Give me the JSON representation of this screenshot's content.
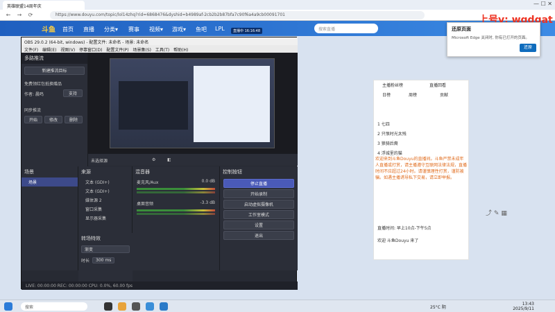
{
  "browser": {
    "tab_title": "英雄联盟14周年庆",
    "url": "https://www.douyu.com/topic/lol14zhq?rid=6868476&dyshid=b4989af-2cb2b2b87bfa7c90f6a4a9cb00091701",
    "window_controls": "—  ☐  ✕"
  },
  "douyu": {
    "logo": "斗鱼",
    "nav": [
      "首页",
      "直播",
      "分类▾",
      "赛事",
      "视频▾",
      "游戏▾",
      "鱼吧",
      "LPL"
    ],
    "live_badge": "直播中 16:16:48",
    "search_placeholder": "搜索直播",
    "watermark": "上号v: wgdgat",
    "right_panel": {
      "tabs": [
        "主播粉丝榜",
        "直播回看"
      ],
      "subtabs": [
        "日榜",
        "周榜",
        "贡献"
      ],
      "ranks": [
        "1 七四",
        "2 只恨时光太残",
        "3 狼骑后裔",
        "4 浮城里的猫"
      ],
      "chat": "欢迎来到斗鱼Douyu的直播间。斗鱼严禁未成年人直播或打赏，请主播遵守互联网法律法规，直播时间不应超过24小时。请谨慎理性打赏，谨防被骗。如遇主播诱导私下交易，请立即举报。",
      "notice": "直播时间: 早上10点-下午5点",
      "welcome": "欢迎 斗鱼Douyu 来了"
    }
  },
  "edge_popup": {
    "title": "还原页面",
    "desc": "Microsoft Edge 关闭时, 你有已打开的页面。",
    "button": "还原"
  },
  "obs": {
    "title": "OBS 29.0.2 (64-bit, windows) - 配置文件: 未命名 - 场景: 未命名",
    "menu": "文件(F) 编辑(E) 视图(V) 停靠窗口(D) 配置文件(P) 场景集(S) 工具(T) 帮助(H)",
    "dock_title": "多路推流",
    "create_target": "新建推流目标",
    "promo": "免费领红包抵换赠品",
    "author": "作者: 晨鸣",
    "support": "支持",
    "sync_label": "同步推流",
    "sync_buttons": [
      "开始",
      "修改",
      "删除"
    ],
    "scene_label": "未选择源",
    "scenes_header": "场景",
    "scene_item": "场景",
    "sources_header": "来源",
    "sources": [
      "文本 (GDI+)",
      "文本 (GDI+)",
      "媒体源 2",
      "窗口采集",
      "显示器采集"
    ],
    "mixer_header": "混音器",
    "mixer": [
      {
        "name": "麦克风/Aux",
        "level": "0.0 dB"
      },
      {
        "name": "桌面音频",
        "level": "-3.3 dB"
      }
    ],
    "controls_header": "控制按钮",
    "controls": [
      "停止直播",
      "开始录制",
      "启动虚拟摄像机",
      "工作室模式",
      "设置",
      "退出"
    ],
    "transitions_header": "转场特效",
    "transition": "渐变",
    "duration_label": "时长",
    "duration": "300 ms",
    "status": "LIVE: 00:00:00   REC: 00:00:00   CPU: 0.0%, 60.00 fps"
  },
  "taskbar": {
    "search": "搜索",
    "weather": "25°C 阴",
    "time": "13:43",
    "date": "2025/9/11"
  }
}
